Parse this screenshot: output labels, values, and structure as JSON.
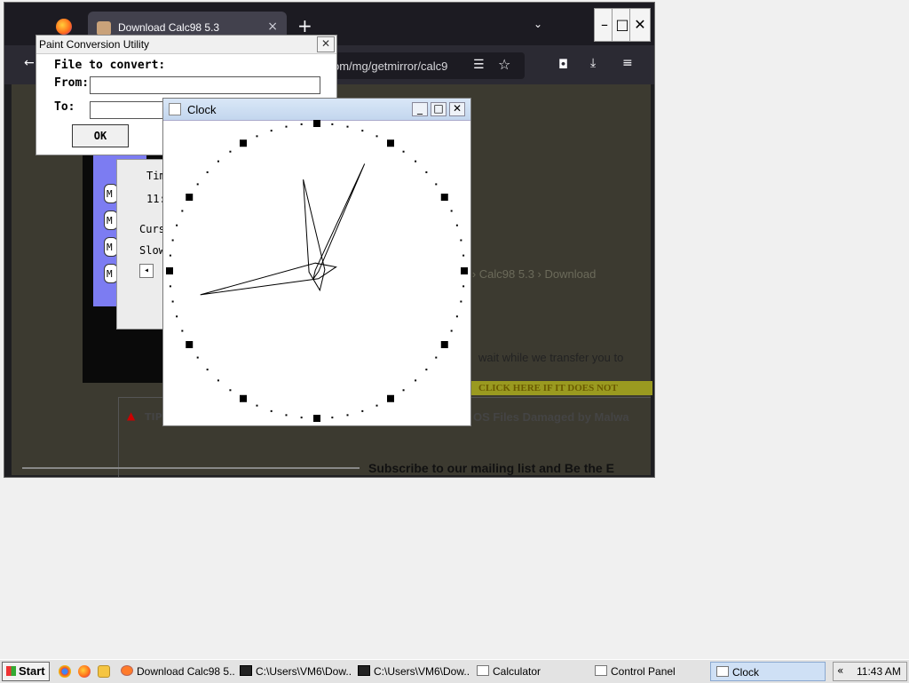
{
  "browser": {
    "tab_title": "Download Calc98 5.3",
    "tab_close": "×",
    "new_tab": "+",
    "tab_list": "⌄",
    "url_fragment": "om/mg/getmirror/calc9",
    "win_min": "–",
    "win_max": "□",
    "win_close": "✕",
    "nav_back": "←",
    "page": {
      "menu_btn_letter": "M",
      "time_group": "Tim",
      "time_value": "11:",
      "cursor_group": "Curs",
      "cursor_value": "Slow",
      "scroll_left": "◂",
      "breadcrumb": "h › Calc98 5.3 › Download",
      "wait_text": "wait while we transfer you to",
      "click_banner": "CLICK HERE IF IT DOES NOT",
      "tip_label": "TIP",
      "damaged_text": "OS Files Damaged by Malwa",
      "subscribe_text": "Subscribe to our mailing list and Be the E"
    }
  },
  "paint_conversion": {
    "title": "Paint Conversion Utility",
    "close": "✕",
    "file_label": "File to convert:",
    "from_label": "From:",
    "to_label": "To:",
    "from_value": "",
    "to_value": "",
    "ok_label": "OK"
  },
  "clock": {
    "title": "Clock",
    "min": "_",
    "max": "□",
    "close": "✕",
    "time": {
      "hour": 11,
      "minute": 43,
      "second": 4
    }
  },
  "taskbar": {
    "start_label": "Start",
    "items": [
      "Download Calc98 5...",
      "C:\\Users\\VM6\\Dow...",
      "C:\\Users\\VM6\\Dow...",
      "Calculator",
      "Control Panel",
      "Clock"
    ],
    "tray_chevron": "«",
    "tray_time": "11:43 AM"
  }
}
